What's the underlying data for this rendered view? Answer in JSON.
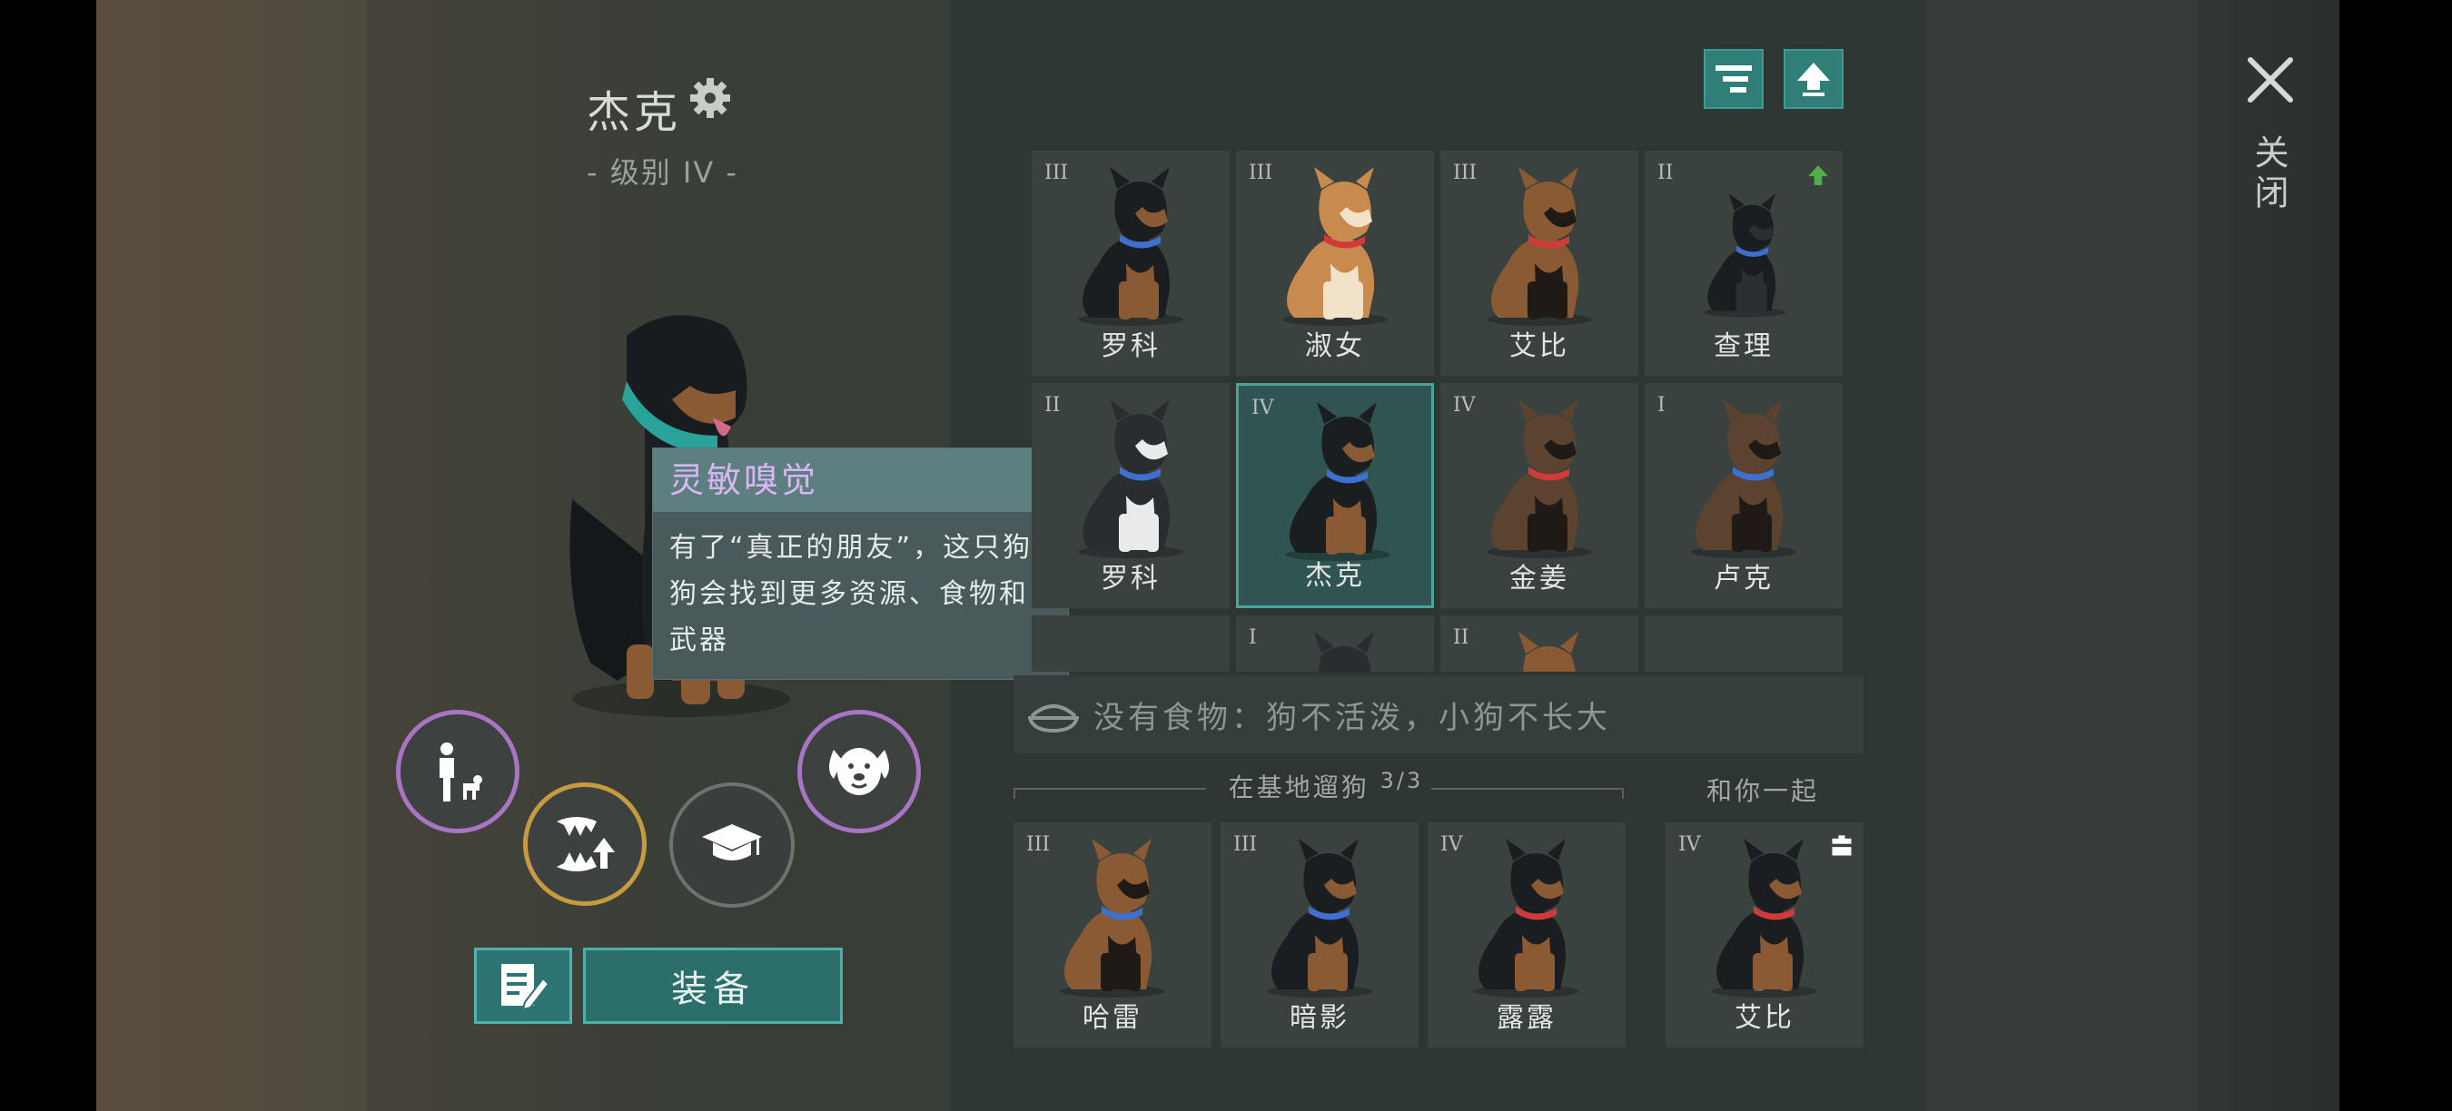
{
  "dog": {
    "name": "杰克",
    "level": "- 级别 IV -"
  },
  "tooltip": {
    "title": "灵敏嗅觉",
    "body": "有了“真正的朋友”，这只狗狗会找到更多资源、食物和武器"
  },
  "buttons": {
    "equip": "装备"
  },
  "kennel": {
    "dogs": [
      {
        "rank": "III",
        "name": "罗科",
        "breed": "rottweiler",
        "collar": "#3e6fd1"
      },
      {
        "rank": "III",
        "name": "淑女",
        "breed": "shiba",
        "collar": "#d13a3a"
      },
      {
        "rank": "III",
        "name": "艾比",
        "breed": "shepherd",
        "collar": "#d13a3a"
      },
      {
        "rank": "II",
        "name": "查理",
        "breed": "puppy",
        "collar": "#3e6fd1",
        "upgrade": true
      },
      {
        "rank": "II",
        "name": "罗科",
        "breed": "husky",
        "collar": "#3e6fd1"
      },
      {
        "rank": "IV",
        "name": "杰克",
        "breed": "rottweiler",
        "collar": "#3e6fd1",
        "selected": true
      },
      {
        "rank": "IV",
        "name": "金姜",
        "breed": "shepherd-dark",
        "collar": "#d13a3a"
      },
      {
        "rank": "I",
        "name": "卢克",
        "breed": "shepherd-dark",
        "collar": "#3e6fd1"
      },
      {
        "rank": "",
        "name": "",
        "breed": "none"
      },
      {
        "rank": "I",
        "name": "",
        "breed": "husky"
      },
      {
        "rank": "II",
        "name": "",
        "breed": "shepherd"
      },
      {
        "rank": "",
        "name": "",
        "breed": "none"
      }
    ]
  },
  "food_status": "没有食物：狗不活泼，小狗不长大",
  "walk": {
    "title": "在基地遛狗",
    "count": "3/3",
    "dogs": [
      {
        "rank": "III",
        "name": "哈雷",
        "breed": "shepherd",
        "collar": "#3e6fd1"
      },
      {
        "rank": "III",
        "name": "暗影",
        "breed": "rottweiler",
        "collar": "#3e6fd1"
      },
      {
        "rank": "IV",
        "name": "露露",
        "breed": "rottweiler",
        "collar": "#d13a3a"
      }
    ]
  },
  "with_you": {
    "title": "和你一起",
    "dog": {
      "rank": "IV",
      "name": "艾比",
      "breed": "rottweiler",
      "collar": "#d13a3a"
    }
  },
  "close_label": "关闭",
  "colors": {
    "accent_teal": "#2f7e78",
    "tooltip_title": "#d9b6f3",
    "ring_purple": "#a874c4",
    "ring_gold": "#c69a3e"
  }
}
